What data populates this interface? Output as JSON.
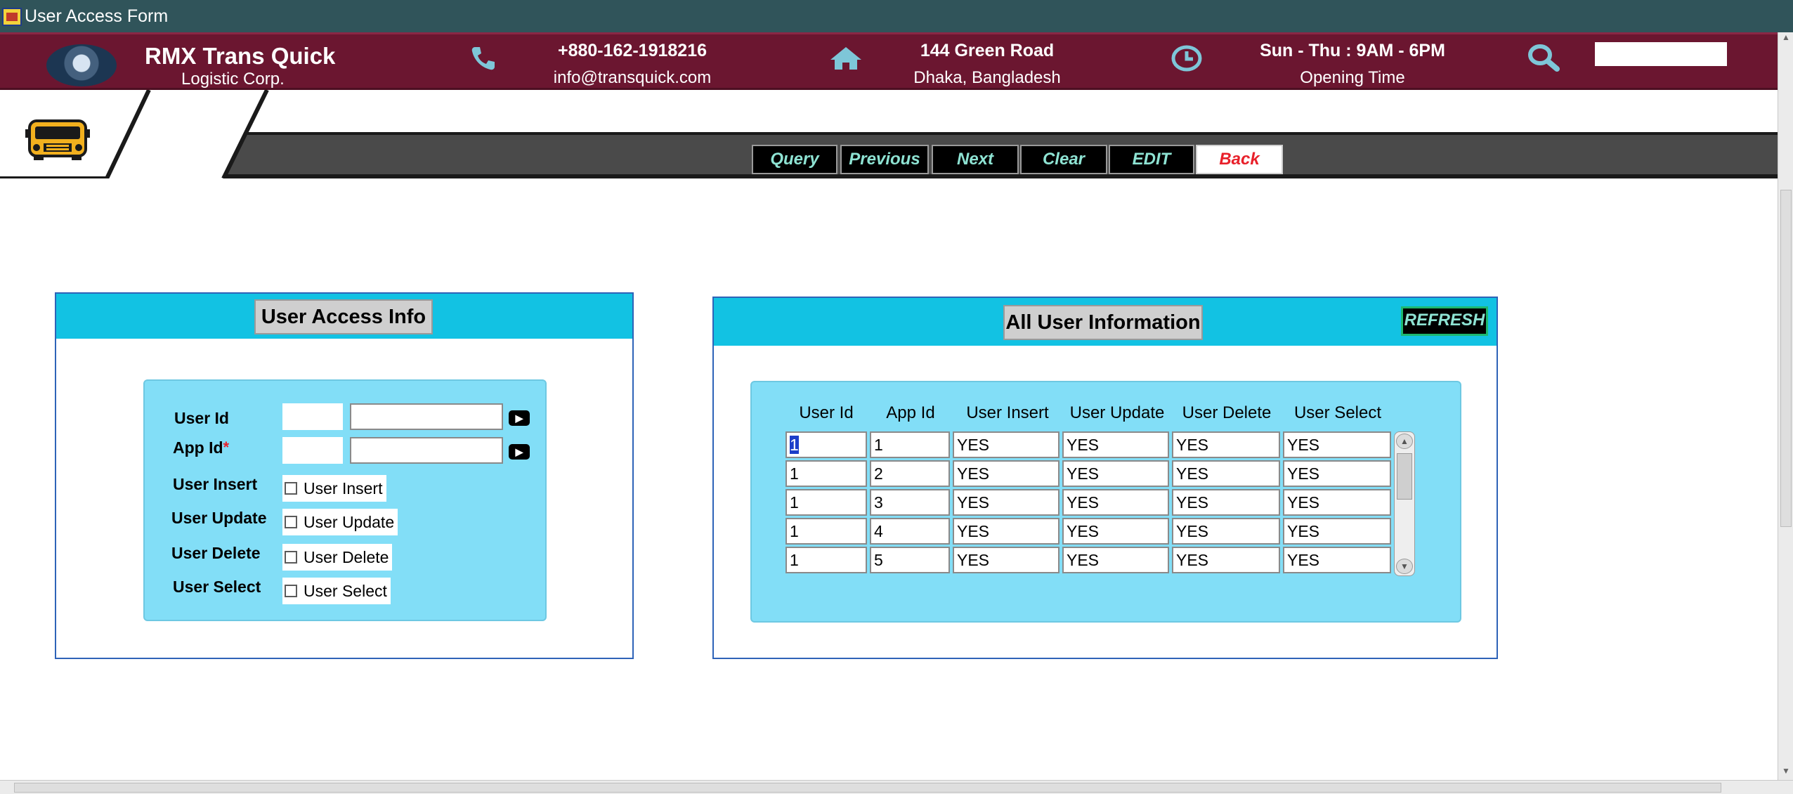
{
  "window": {
    "title": "User Access Form"
  },
  "header": {
    "company_name": "RMX Trans Quick",
    "company_sub": "Logistic Corp.",
    "phone": "+880-162-1918216",
    "email": "info@transquick.com",
    "address_line1": "144 Green Road",
    "address_line2": "Dhaka, Bangladesh",
    "hours": "Sun - Thu : 9AM - 6PM",
    "hours_label": "Opening Time",
    "search_value": ""
  },
  "toolbar": {
    "query": "Query",
    "previous": "Previous",
    "next": "Next",
    "clear": "Clear",
    "edit": "EDIT",
    "back": "Back"
  },
  "access_panel": {
    "title": "User Access Info",
    "labels": {
      "user_id": "User Id",
      "app_id": "App Id",
      "required_mark": "*",
      "user_insert": "User Insert",
      "user_update": "User Update",
      "user_delete": "User Delete",
      "user_select": "User Select"
    },
    "checkboxes": {
      "user_insert": "User Insert",
      "user_update": "User Update",
      "user_delete": "User Delete",
      "user_select": "User Select"
    },
    "values": {
      "user_id": "",
      "user_name": "",
      "app_id": "",
      "app_name": ""
    }
  },
  "users_panel": {
    "title": "All User Information",
    "refresh": "REFRESH",
    "columns": [
      "User Id",
      "App Id",
      "User Insert",
      "User Update",
      "User Delete",
      "User Select"
    ],
    "rows": [
      [
        "1",
        "1",
        "YES",
        "YES",
        "YES",
        "YES"
      ],
      [
        "1",
        "2",
        "YES",
        "YES",
        "YES",
        "YES"
      ],
      [
        "1",
        "3",
        "YES",
        "YES",
        "YES",
        "YES"
      ],
      [
        "1",
        "4",
        "YES",
        "YES",
        "YES",
        "YES"
      ],
      [
        "1",
        "5",
        "YES",
        "YES",
        "YES",
        "YES"
      ]
    ]
  },
  "colors": {
    "header": "#6b1630",
    "panel_head": "#12c2e3",
    "panel_inner": "#82def7",
    "button_text": "#8ee3d3",
    "back_text": "#e8202a"
  }
}
